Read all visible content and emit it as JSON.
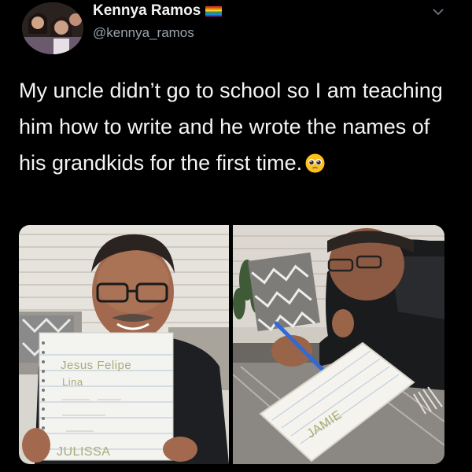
{
  "user": {
    "display_name": "Kennya Ramos",
    "handle": "@kennya_ramos",
    "flag_icon": "rainbow-flag-icon",
    "avatar_icon": "profile-photo-avatar"
  },
  "tweet": {
    "text": "My uncle didn’t go to school so I am teaching him how to write and he wrote the names of his grandkids for the first time.",
    "emoji": "pleading-face-emoji"
  },
  "media": {
    "left_photo": {
      "notebook_line_1": "Jesus Felipe",
      "notebook_line_2": "Lina",
      "notebook_line_bottom": "JULISSA"
    },
    "right_photo": {
      "notebook_text": "JAMIE"
    }
  },
  "colors": {
    "background": "#000000",
    "text": "#f4f4f4",
    "handle": "#9aa4ad"
  }
}
